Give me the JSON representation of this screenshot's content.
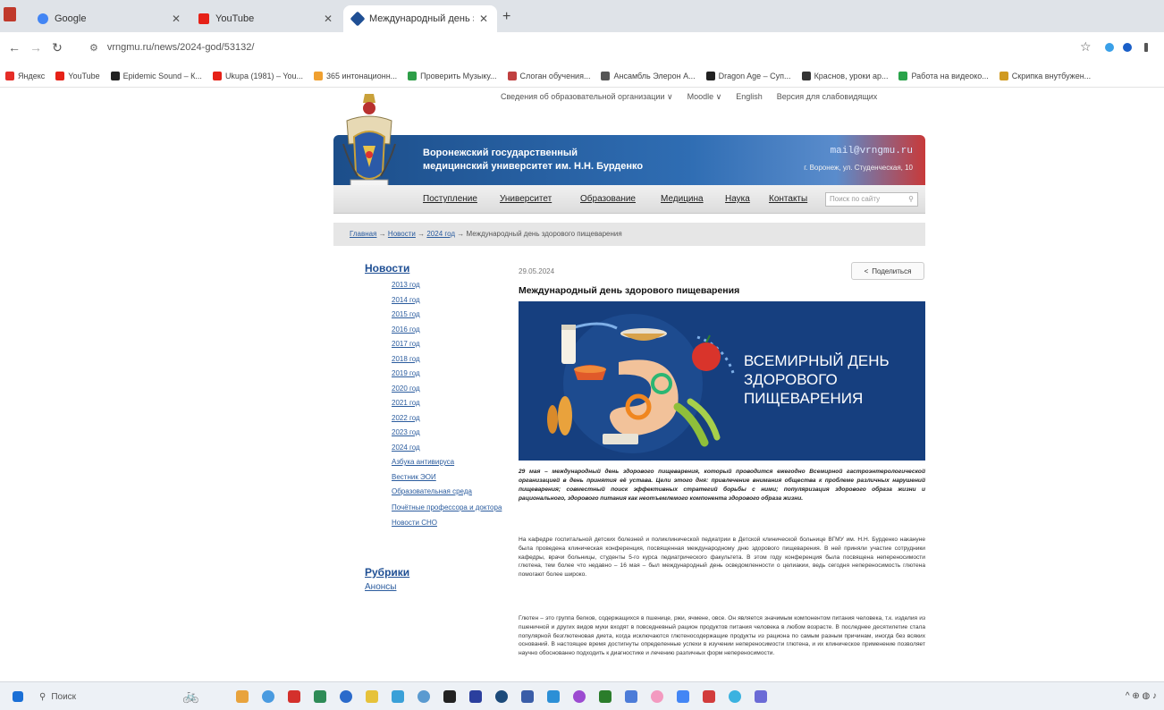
{
  "browser": {
    "tabs": [
      {
        "label": "Google",
        "color": "#4285f4",
        "active": false
      },
      {
        "label": "YouTube",
        "color": "#e62117",
        "active": false
      },
      {
        "label": "Международный день здоро",
        "color": "#1f4f94",
        "active": true
      }
    ],
    "url": "vrngmu.ru/news/2024-god/53132/",
    "bookmarks": [
      {
        "label": "Яндекс",
        "color": "#e52d27"
      },
      {
        "label": "YouTube",
        "color": "#e62117"
      },
      {
        "label": "Epidemic Sound – К...",
        "color": "#222222"
      },
      {
        "label": "Ukupa (1981) – You...",
        "color": "#e62117"
      },
      {
        "label": "365 интонационн...",
        "color": "#f0a030"
      },
      {
        "label": "Проверить Музыку...",
        "color": "#2e9e48"
      },
      {
        "label": "Слоган обучения...",
        "color": "#c04040"
      },
      {
        "label": "Ансамбль Элерон А...",
        "color": "#555555"
      },
      {
        "label": "Dragon Age – Суп...",
        "color": "#222222"
      },
      {
        "label": "Краснов, уроки ар...",
        "color": "#333333"
      },
      {
        "label": "Работа на видеоко...",
        "color": "#2aa34a"
      },
      {
        "label": "Скрипка внутбужен...",
        "color": "#d09a20"
      }
    ]
  },
  "site": {
    "top_links": [
      "Сведения об образовательной организации ∨",
      "Moodle ∨",
      "English",
      "Версия для слабовидящих"
    ],
    "university_line1": "Воронежский государственный",
    "university_line2": "медицинский университет им. Н.Н. Бурденко",
    "email": "mail@vrngmu.ru",
    "address": "г. Воронеж, ул. Студенческая, 10",
    "nav": [
      "Поступление",
      "Университет",
      "Образование",
      "Медицина",
      "Наука",
      "Контакты"
    ],
    "search_placeholder": "Поиск по сайту",
    "breadcrumb": {
      "links": [
        "Главная",
        "Новости",
        "2024 год"
      ],
      "separator": "→",
      "current": "Международный день здорового пищеварения"
    }
  },
  "sidebar": {
    "title": "Новости",
    "items": [
      "2013 год",
      "2014 год",
      "2015 год",
      "2016 год",
      "2017 год",
      "2018 год",
      "2019 год",
      "2020 год",
      "2021 год",
      "2022 год",
      "2023 год",
      "2024 год",
      "Азбука антивируса",
      "Вестник ЭОИ",
      "Образовательная среда",
      "Почётные профессора и доктора",
      "Новости СНО"
    ],
    "rubrics": "Рубрики",
    "announcements": "Анонсы"
  },
  "article": {
    "date": "29.05.2024",
    "share_label": "Поделиться",
    "title": "Международный день здорового пищеварения",
    "hero_text": [
      "ВСЕМИРНЫЙ ДЕНЬ",
      "ЗДОРОВОГО",
      "ПИЩЕВАРЕНИЯ"
    ],
    "hero_bg": "#163f7f",
    "lead": "29 мая – международный день здорового пищеварения, который проводится ежегодно Всемирной гастроэнтерологической организацией в день принятия её устава. Цели этого дня: привлечение внимания общества к проблеме различных нарушений пищеварения; совместный поиск эффективных стратегий борьбы с ними; популяризация здорового образа жизни и рационального, здорового питания как неотъемлемого компонента здорового образа жизни.",
    "paragraph1": "На кафедре госпитальной детских болезней и поликлинической педиатрии в Детской клинической больнице ВГМУ им. Н.Н. Бурденко накануне была проведена клиническая конференция, посвященная международному дню здорового пищеварения. В ней приняли участие сотрудники кафедры, врачи больницы, студенты 5-го курса педиатрического факультета. В этом году конференция была посвящена непереносимости глютена, тем более что недавно – 16 мая – был международный день осведомленности о целиакии, ведь сегодня непереносимость глютена помогают более широко.",
    "paragraph2": "Глютен – это группа белков, содержащихся в пшенице, ржи, ячмене, овсе. Он является значимым компонентом питания человека, т.к. изделия из пшеничной и других видов муки входят в повседневный рацион продуктов питания человека в любом возрасте. В последнее десятилетие стала популярной безглютеновая диета, когда исключаются глютеносодержащие продукты из рациона по самым разным причинам, иногда без всяких оснований. В настоящее время достигнуты определенные успехи в изучении непереносимости глютена, и их клиническое применение позволяет научно обоснованно подходить к диагностике и лечению различных форм непереносимости."
  },
  "taskbar": {
    "search_label": "Поиск",
    "icon_colors": [
      "#e8a33d",
      "#4a9be0",
      "#d4302c",
      "#2e8b57",
      "#2a6acb",
      "#e6c23a",
      "#3aa0d8",
      "#5a9ad0",
      "#222222",
      "#2b3f9e",
      "#1c4a7a",
      "#3a5da8",
      "#2c8fd6",
      "#9c4bd1",
      "#2b7d2b",
      "#4c7cd8",
      "#f39ac0",
      "#4386f5",
      "#d23c3c",
      "#3bb2e0",
      "#6b6bd6"
    ],
    "tray_text": "^ ⊕ ◍ ♪"
  }
}
